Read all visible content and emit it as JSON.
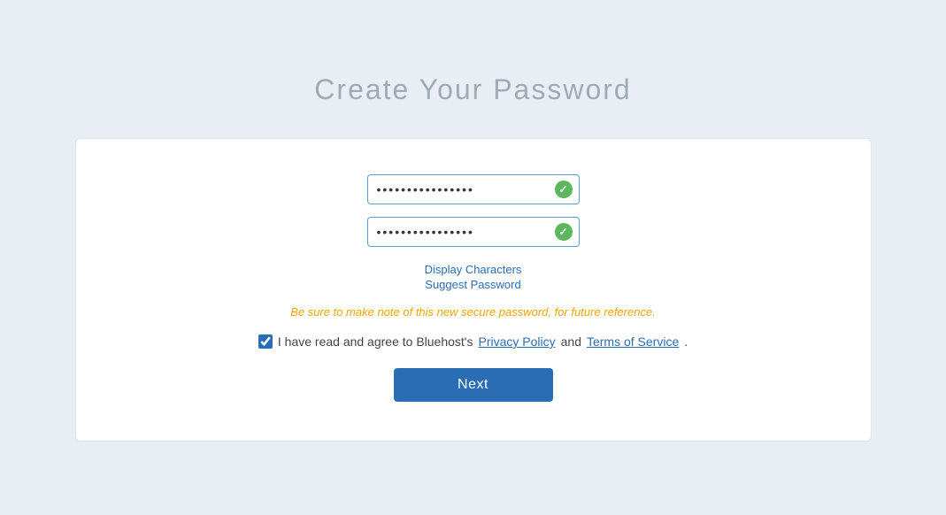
{
  "page": {
    "title": "Create Your Password"
  },
  "form": {
    "password_placeholder": "••••••••••••••••••",
    "confirm_placeholder": "•••••••••••••••••",
    "display_characters_label": "Display Characters",
    "suggest_password_label": "Suggest Password",
    "warning_text": "Be sure to make note of this new secure password, for future reference.",
    "agree_text_before": "I have read and agree to Bluehost's ",
    "agree_privacy_label": "Privacy Policy",
    "agree_and": " and ",
    "agree_tos_label": "Terms of Service",
    "agree_period": ".",
    "next_button_label": "Next",
    "password_value": "••••••••••••••••••",
    "confirm_value": "•••••••••••••••••"
  },
  "colors": {
    "background": "#e8eef4",
    "card_border": "#dde4ea",
    "input_border": "#5b9bd5",
    "check_green": "#5cb85c",
    "warning_orange": "#f0a500",
    "link_blue": "#2a6db5",
    "button_blue": "#2a6db5",
    "title_gray": "#a0aab4"
  }
}
